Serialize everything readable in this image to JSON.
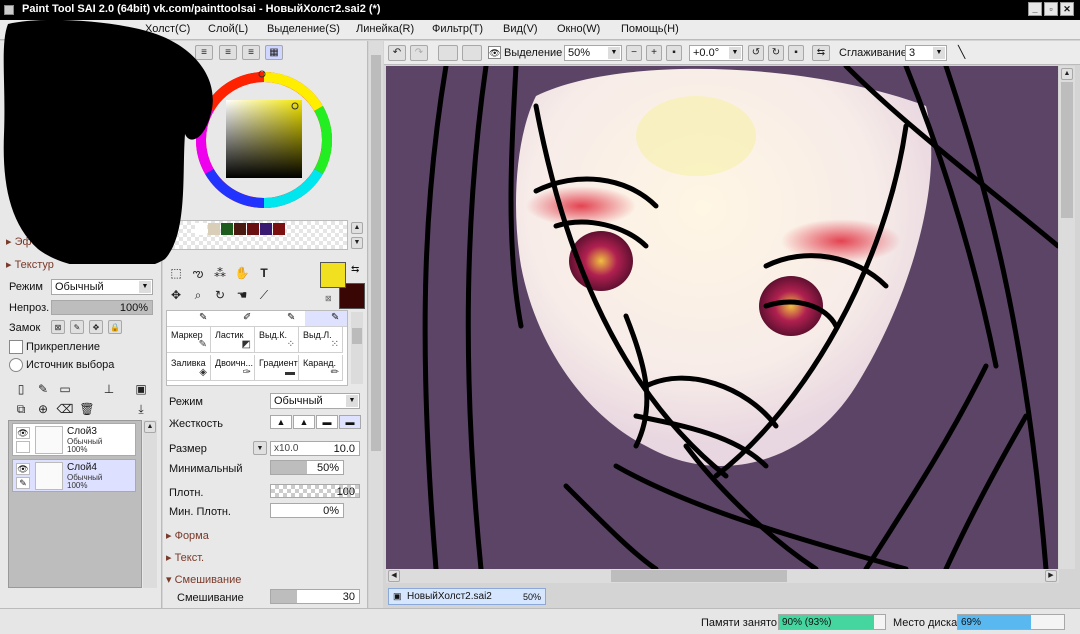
{
  "window": {
    "title": "Paint Tool SAI 2.0 (64bit) vk.com/painttoolsai - НовыйХолст2.sai2 (*)"
  },
  "menu": [
    "Холст(C)",
    "Слой(L)",
    "Выделение(S)",
    "Линейка(R)",
    "Фильтр(T)",
    "Вид(V)",
    "Окно(W)",
    "Помощь(H)"
  ],
  "toolbar": {
    "selection_label": "Выделение",
    "zoom": "50%",
    "rotation": "+0.0°",
    "smoothing_label": "Сглаживание",
    "smoothing_value": "3"
  },
  "left_panel": {
    "effects_label": "Эф",
    "texture_label": "Текстур",
    "mode_label": "Режим",
    "mode_value": "Обычный",
    "opacity_label": "Непроз.",
    "opacity_value": "100%",
    "opacity_level": 1.0,
    "lock_label": "Замок",
    "clipping_label": "Прикрепление",
    "selection_source_label": "Источник выбора",
    "layers": [
      {
        "name": "Слой3",
        "mode": "Обычный",
        "opacity": "100%",
        "selected": false
      },
      {
        "name": "Слой4",
        "mode": "Обычный",
        "opacity": "100%",
        "selected": true
      }
    ]
  },
  "colors": {
    "primary": "#f0e020",
    "secondary": "#3a0505",
    "swatches": [
      "#ffffff",
      "#d9cfb8",
      "#1e5c1e",
      "#4a1a10",
      "#6a1010",
      "#3a1a70",
      "#7a1010"
    ]
  },
  "tools": {
    "brushes": [
      {
        "name": "Маркер",
        "icon": "marker-icon"
      },
      {
        "name": "Ластик",
        "icon": "eraser-icon"
      },
      {
        "name": "Выд.К.",
        "icon": "select-pen-icon"
      },
      {
        "name": "Выд.Л.",
        "icon": "select-eraser-icon"
      },
      {
        "name": "Заливка",
        "icon": "bucket-icon"
      },
      {
        "name": "Двоичн...",
        "icon": "binary-pen-icon"
      },
      {
        "name": "Градиент",
        "icon": "gradient-icon"
      },
      {
        "name": "Каранд.",
        "icon": "pencil-icon"
      }
    ]
  },
  "brush_settings": {
    "mode_label": "Режим",
    "mode_value": "Обычный",
    "hardness_label": "Жесткость",
    "size_label": "Размер",
    "size_multiplier": "x10.0",
    "size_value": "10.0",
    "min_size_label": "Минимальный",
    "min_size_value": "50%",
    "min_size_level": 0.5,
    "density_label": "Плотн.",
    "density_value": "100",
    "min_density_label": "Мин. Плотн.",
    "min_density_value": "0%",
    "shape_label": "Форма",
    "texture_label": "Текст.",
    "blending_section_label": "Смешивание",
    "blending_label": "Смешивание",
    "blending_value": "30",
    "blending_level": 0.3
  },
  "canvas": {
    "background": "#5c4466",
    "tab_name": "НовыйХолст2.sai2",
    "tab_zoom": "50%"
  },
  "status": {
    "memory_label": "Памяти занято",
    "memory_value": "90% (93%)",
    "memory_level": 0.9,
    "disk_label": "Место диска",
    "disk_value": "69%",
    "disk_level": 0.69
  }
}
